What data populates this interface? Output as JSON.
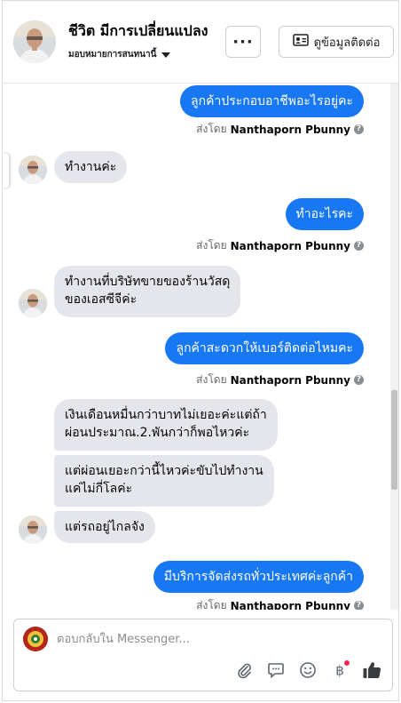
{
  "header": {
    "title": "ชีวิต มีการเปลี่ยนแปลง",
    "subtitle": "มอบหมายการสนทนานี้",
    "more_label": "···",
    "contact_label": "ดูข้อมูลติดต่อ"
  },
  "sent_by_prefix": "ส่งโดย",
  "messages": [
    {
      "text": "ลูกค้าประกอบอาชีพอะไรอยู่คะ",
      "sender": "Nanthaporn Pbunny"
    },
    {
      "text": "ทำงานค่ะ"
    },
    {
      "text": "ทำอะไรคะ",
      "sender": "Nanthaporn Pbunny"
    },
    {
      "text": "ทำงานที่บริษัทขายของร้านวัสดุ\nของเอสซีจีค่ะ"
    },
    {
      "text": "ลูกค้าสะดวกให้เบอร์ติดต่อไหมคะ",
      "sender": "Nanthaporn Pbunny"
    },
    {
      "text": "เงินเดือนหมื่นกว่าบาทไม่เยอะค่ะแต่ถ้า\nผ่อนประมาณ.2.พันกว่าก็พอไหวค่ะ"
    },
    {
      "text": "แต่ผ่อนเยอะกว่านี้ไหวค่ะขับไปทำงาน\nแค่ไม่กี่โลค่ะ"
    },
    {
      "text": "แต่รถอยู่ไกลจัง"
    },
    {
      "text": "มีบริการจัดส่งรถทั่วประเทศค่ะลูกค้า",
      "sender": "Nanthaporn Pbunny"
    }
  ],
  "composer": {
    "placeholder": "ตอบกลับใน Messenger..."
  },
  "icons": [
    "more-icon",
    "contact-card-icon",
    "caret-down-icon",
    "help-icon",
    "attachment-icon",
    "saved-reply-icon",
    "emoji-icon",
    "baht-icon",
    "like-icon"
  ],
  "colors": {
    "outgoing_bubble": "#1877f2",
    "incoming_bubble": "#e4e6eb",
    "notification_dot": "#f02849"
  }
}
